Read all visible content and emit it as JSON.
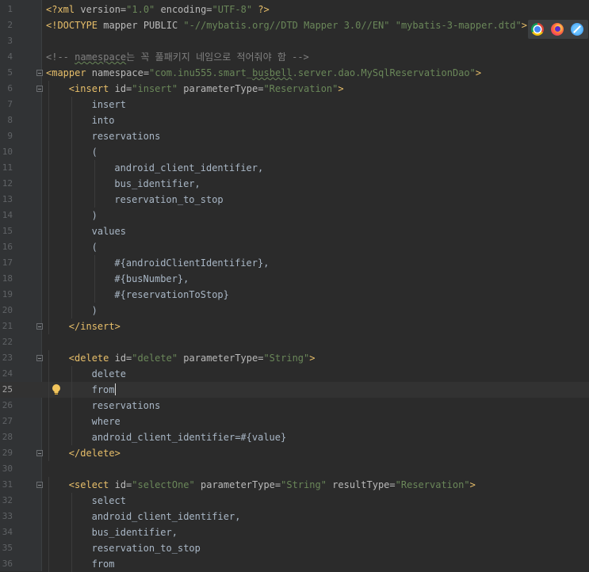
{
  "editor": {
    "current_line": 25,
    "lines": [
      {
        "n": "1",
        "indent": 0,
        "fold": false,
        "tokens": [
          [
            "decl",
            "<?xml "
          ],
          [
            "attr",
            "version="
          ],
          [
            "str",
            "\"1.0\""
          ],
          [
            "attr",
            " encoding="
          ],
          [
            "str",
            "\"UTF-8\""
          ],
          [
            "decl",
            " ?>"
          ]
        ]
      },
      {
        "n": "2",
        "indent": 0,
        "fold": false,
        "tokens": [
          [
            "decl",
            "<!DOCTYPE "
          ],
          [
            "attr",
            "mapper PUBLIC "
          ],
          [
            "str",
            "\"-//mybatis.org//DTD Mapper 3.0//EN\""
          ],
          [
            "attr",
            " "
          ],
          [
            "str",
            "\"mybatis-3-mapper.dtd\""
          ],
          [
            "decl",
            ">"
          ]
        ]
      },
      {
        "n": "3",
        "indent": 0,
        "fold": false,
        "tokens": []
      },
      {
        "n": "4",
        "indent": 0,
        "fold": false,
        "tokens": [
          [
            "comment",
            "<!-- "
          ],
          [
            "comment squiggle",
            "namespace"
          ],
          [
            "comment",
            "는 꼭 풀패키지 네임으로 적어줘야 함 -->"
          ]
        ]
      },
      {
        "n": "5",
        "indent": 0,
        "fold": true,
        "tokens": [
          [
            "tag",
            "<mapper "
          ],
          [
            "attr",
            "namespace="
          ],
          [
            "str",
            "\"com.inu555.smart_"
          ],
          [
            "str squiggle",
            "busbell"
          ],
          [
            "str",
            ".server.dao.MySqlReservationDao\""
          ],
          [
            "tag",
            ">"
          ]
        ]
      },
      {
        "n": "6",
        "indent": 4,
        "fold": true,
        "tokens": [
          [
            "tag",
            "<insert "
          ],
          [
            "attr",
            "id="
          ],
          [
            "str",
            "\"insert\""
          ],
          [
            "attr",
            " parameterType="
          ],
          [
            "str",
            "\"Reservation\""
          ],
          [
            "tag",
            ">"
          ]
        ]
      },
      {
        "n": "7",
        "indent": 8,
        "fold": false,
        "tokens": [
          [
            "text",
            "insert"
          ]
        ]
      },
      {
        "n": "8",
        "indent": 8,
        "fold": false,
        "tokens": [
          [
            "text",
            "into"
          ]
        ]
      },
      {
        "n": "9",
        "indent": 8,
        "fold": false,
        "tokens": [
          [
            "text",
            "reservations"
          ]
        ]
      },
      {
        "n": "10",
        "indent": 8,
        "fold": false,
        "tokens": [
          [
            "text",
            "("
          ]
        ]
      },
      {
        "n": "11",
        "indent": 12,
        "fold": false,
        "tokens": [
          [
            "text",
            "android_client_identifier,"
          ]
        ]
      },
      {
        "n": "12",
        "indent": 12,
        "fold": false,
        "tokens": [
          [
            "text",
            "bus_identifier,"
          ]
        ]
      },
      {
        "n": "13",
        "indent": 12,
        "fold": false,
        "tokens": [
          [
            "text",
            "reservation_to_stop"
          ]
        ]
      },
      {
        "n": "14",
        "indent": 8,
        "fold": false,
        "tokens": [
          [
            "text",
            ")"
          ]
        ]
      },
      {
        "n": "15",
        "indent": 8,
        "fold": false,
        "tokens": [
          [
            "text",
            "values"
          ]
        ]
      },
      {
        "n": "16",
        "indent": 8,
        "fold": false,
        "tokens": [
          [
            "text",
            "("
          ]
        ]
      },
      {
        "n": "17",
        "indent": 12,
        "fold": false,
        "tokens": [
          [
            "text",
            "#{androidClientIdentifier},"
          ]
        ]
      },
      {
        "n": "18",
        "indent": 12,
        "fold": false,
        "tokens": [
          [
            "text",
            "#{busNumber},"
          ]
        ]
      },
      {
        "n": "19",
        "indent": 12,
        "fold": false,
        "tokens": [
          [
            "text",
            "#{reservationToStop}"
          ]
        ]
      },
      {
        "n": "20",
        "indent": 8,
        "fold": false,
        "tokens": [
          [
            "text",
            ")"
          ]
        ]
      },
      {
        "n": "21",
        "indent": 4,
        "fold": true,
        "tokens": [
          [
            "tag",
            "</insert>"
          ]
        ]
      },
      {
        "n": "22",
        "indent": 0,
        "fold": false,
        "tokens": []
      },
      {
        "n": "23",
        "indent": 4,
        "fold": true,
        "tokens": [
          [
            "tag",
            "<delete "
          ],
          [
            "attr",
            "id="
          ],
          [
            "str",
            "\"delete\""
          ],
          [
            "attr",
            " parameterType="
          ],
          [
            "str",
            "\"String\""
          ],
          [
            "tag",
            ">"
          ]
        ]
      },
      {
        "n": "24",
        "indent": 8,
        "fold": false,
        "tokens": [
          [
            "text",
            "delete"
          ]
        ]
      },
      {
        "n": "25",
        "indent": 8,
        "fold": false,
        "tokens": [
          [
            "text",
            "from"
          ]
        ],
        "caret": true,
        "bulb": true
      },
      {
        "n": "26",
        "indent": 8,
        "fold": false,
        "tokens": [
          [
            "text",
            "reservations"
          ]
        ]
      },
      {
        "n": "27",
        "indent": 8,
        "fold": false,
        "tokens": [
          [
            "text",
            "where"
          ]
        ]
      },
      {
        "n": "28",
        "indent": 8,
        "fold": false,
        "tokens": [
          [
            "text",
            "android_client_identifier=#{value}"
          ]
        ]
      },
      {
        "n": "29",
        "indent": 4,
        "fold": true,
        "tokens": [
          [
            "tag",
            "</delete>"
          ]
        ]
      },
      {
        "n": "30",
        "indent": 0,
        "fold": false,
        "tokens": []
      },
      {
        "n": "31",
        "indent": 4,
        "fold": true,
        "tokens": [
          [
            "tag",
            "<select "
          ],
          [
            "attr",
            "id="
          ],
          [
            "str",
            "\"selectOne\""
          ],
          [
            "attr",
            " parameterType="
          ],
          [
            "str",
            "\"String\""
          ],
          [
            "attr",
            " resultType="
          ],
          [
            "str",
            "\"Reservation\""
          ],
          [
            "tag",
            ">"
          ]
        ]
      },
      {
        "n": "32",
        "indent": 8,
        "fold": false,
        "tokens": [
          [
            "text",
            "select"
          ]
        ]
      },
      {
        "n": "33",
        "indent": 8,
        "fold": false,
        "tokens": [
          [
            "text",
            "android_client_identifier,"
          ]
        ]
      },
      {
        "n": "34",
        "indent": 8,
        "fold": false,
        "tokens": [
          [
            "text",
            "bus_identifier,"
          ]
        ]
      },
      {
        "n": "35",
        "indent": 8,
        "fold": false,
        "tokens": [
          [
            "text",
            "reservation_to_stop"
          ]
        ]
      },
      {
        "n": "36",
        "indent": 8,
        "fold": false,
        "tokens": [
          [
            "text",
            "from"
          ]
        ]
      }
    ]
  },
  "browser_icons": [
    {
      "name": "chrome-icon",
      "color": "#4caf50"
    },
    {
      "name": "firefox-icon",
      "color": "#ff7139"
    },
    {
      "name": "safari-icon",
      "color": "#2d8cf0"
    }
  ]
}
